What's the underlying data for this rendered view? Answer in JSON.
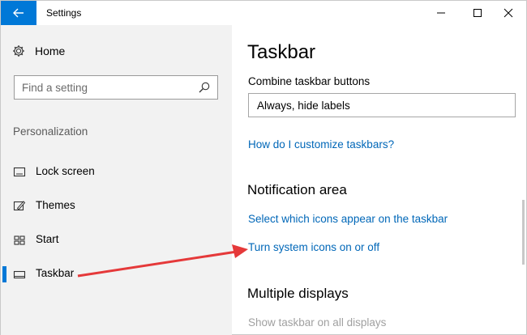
{
  "window": {
    "title": "Settings",
    "accent_color": "#0078d7"
  },
  "sidebar": {
    "home_label": "Home",
    "search_placeholder": "Find a setting",
    "section": "Personalization",
    "items": [
      {
        "label": "Lock screen",
        "icon": "lock-screen-icon"
      },
      {
        "label": "Themes",
        "icon": "themes-icon"
      },
      {
        "label": "Start",
        "icon": "start-icon"
      },
      {
        "label": "Taskbar",
        "icon": "taskbar-icon",
        "selected": true
      }
    ]
  },
  "main": {
    "title": "Taskbar",
    "combine_label": "Combine taskbar buttons",
    "combine_value": "Always, hide labels",
    "link_customize": "How do I customize taskbars?",
    "notification_heading": "Notification area",
    "link_select_icons": "Select which icons appear on the taskbar",
    "link_system_icons": "Turn system icons on or off",
    "multiple_heading": "Multiple displays",
    "show_all_displays": "Show taskbar on all displays"
  },
  "colors": {
    "link": "#0067b8",
    "annotation_arrow": "#e5393a"
  }
}
